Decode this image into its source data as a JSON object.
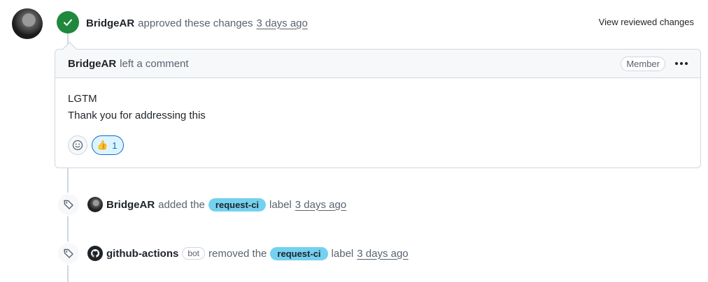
{
  "review": {
    "author": "BridgeAR",
    "action": "approved these changes",
    "time": "3 days ago",
    "view_link": "View reviewed changes"
  },
  "comment": {
    "author": "BridgeAR",
    "action": "left a comment",
    "role_badge": "Member",
    "lines": [
      "LGTM",
      "Thank you for addressing this"
    ],
    "reaction": {
      "emoji": "👍",
      "count": "1"
    }
  },
  "events": [
    {
      "actor": "BridgeAR",
      "verb": "added the",
      "label": "request-ci",
      "suffix": "label",
      "time": "3 days ago",
      "badge": ""
    },
    {
      "actor": "github-actions",
      "verb": "removed the",
      "label": "request-ci",
      "suffix": "label",
      "time": "3 days ago",
      "badge": "bot"
    }
  ],
  "colors": {
    "approve": "#1f883d",
    "label": "#74d1ef",
    "link": "#0969da"
  }
}
